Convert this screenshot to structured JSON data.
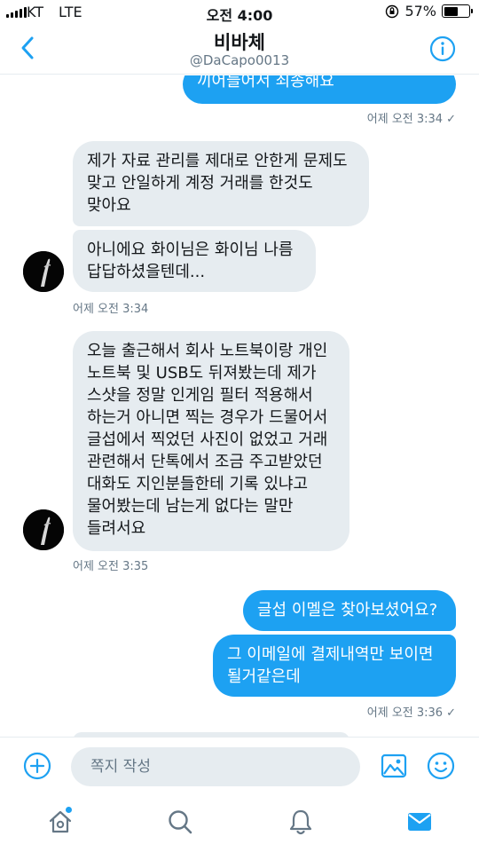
{
  "status_bar": {
    "carrier": "KT",
    "network": "LTE",
    "time": "오전 4:00",
    "battery_percent": "57%",
    "battery_level": 0.57
  },
  "header": {
    "name": "비바체",
    "handle": "@DaCapo0013"
  },
  "messages": [
    {
      "direction": "out",
      "text": "끼어들어서 죄송해요"
    },
    {
      "direction": "timestamp-out",
      "text": "어제 오전 3:34"
    },
    {
      "direction": "in",
      "text": "제가 자료 관리를 제대로 안한게 문제도\n맞고 안일하게 계정 거래를 한것도\n맞아요"
    },
    {
      "direction": "in",
      "text": "아니에요 화이님은 화이님 나름\n답답하셨을텐데..."
    },
    {
      "direction": "timestamp-in",
      "text": "어제 오전 3:34"
    },
    {
      "direction": "in",
      "text": "오늘 출근해서 회사 노트북이랑 개인\n노트북 및 USB도 뒤져봤는데 제가\n스샷을 정말 인게임 필터 적용해서\n하는거 아니면 찍는 경우가 드물어서\n글섭에서 찍었던 사진이 없었고 거래\n관련해서 단톡에서 조금 주고받았던\n대화도 지인분들한테 기록 있냐고\n물어봤는데 남는게 없다는 말만\n들려서요"
    },
    {
      "direction": "timestamp-in",
      "text": "어제 오전 3:35"
    },
    {
      "direction": "out",
      "text": "글섭 이멜은 찾아보셨어요?"
    },
    {
      "direction": "out",
      "text": "그 이메일에 결제내역만 보이면\n될거같은데"
    },
    {
      "direction": "timestamp-out",
      "text": "어제 오전 3:36"
    }
  ],
  "read_mark": "✓",
  "composer": {
    "placeholder": "쪽지 작성"
  },
  "tabs": [
    {
      "name": "home",
      "icon": "home-icon",
      "active": false
    },
    {
      "name": "search",
      "icon": "search-icon",
      "active": false
    },
    {
      "name": "notifications",
      "icon": "bell-icon",
      "active": false
    },
    {
      "name": "messages",
      "icon": "mail-icon",
      "active": true
    }
  ],
  "colors": {
    "accent": "#1da1f2",
    "incoming_bubble": "#e6ecf0",
    "muted_text": "#657786"
  }
}
